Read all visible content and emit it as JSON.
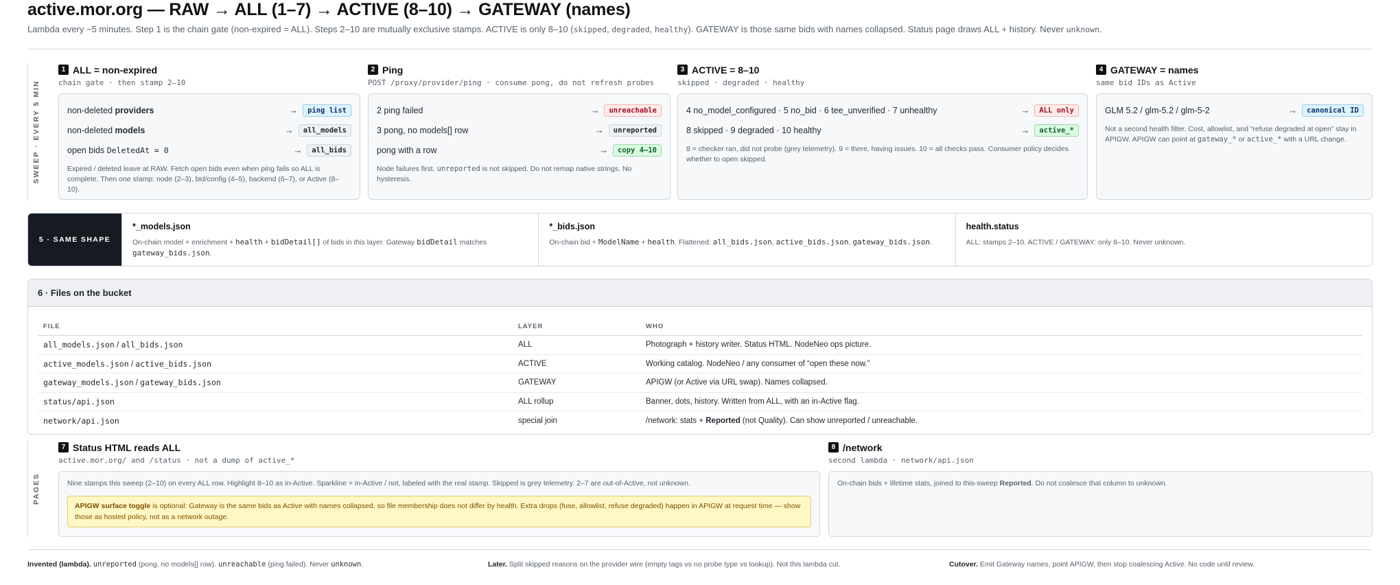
{
  "title": "active.mor.org — RAW → ALL (1–7) → ACTIVE (8–10) → GATEWAY (names)",
  "subtitle": {
    "t1": "Lambda every ~5 minutes. Step 1 is the chain gate (non-expired = ALL). Steps 2–10 are mutually exclusive stamps. ACTIVE is only 8–10 (",
    "m1": "skipped",
    "m2": "degraded",
    "m3": "healthy",
    "t2": "). GATEWAY is those same bids with names collapsed. Status page draws ALL + history. Never ",
    "m4": "unknown",
    "t3": "."
  },
  "sweep_label": "SWEEP · EVERY 5 MIN",
  "pages_label": "PAGES",
  "stages": {
    "s1": {
      "num": "1",
      "title": "ALL = non-expired",
      "sub": "chain gate · then stamp 2–10",
      "rows": [
        {
          "pre": "non-deleted ",
          "bold": "providers",
          "tag": "ping list"
        },
        {
          "pre": "non-deleted ",
          "bold": "models",
          "tag": "all_models"
        },
        {
          "pre": "open bids ",
          "code": "DeletedAt = 0",
          "tag": "all_bids"
        }
      ],
      "note": "Expired / deleted leave at RAW. Fetch open bids even when ping fails so ALL is complete. Then one stamp: node (2–3), bid/config (4–5), backend (6–7), or Active (8–10)."
    },
    "s2": {
      "num": "2",
      "title": "Ping",
      "sub": "POST /proxy/provider/ping · consume pong, do not refresh probes",
      "rows": [
        {
          "text": "2 ping failed",
          "tag": "unreachable"
        },
        {
          "text": "3 pong, no models[] row",
          "tag": "unreported"
        },
        {
          "text": "pong with a row",
          "tag": "copy 4–10"
        }
      ],
      "note_pre": "Node failures first. ",
      "note_code": "unreported",
      "note_post": " is not skipped. Do not remap native strings. No hysteresis."
    },
    "s3": {
      "num": "3",
      "title": "ACTIVE = 8–10",
      "sub": "skipped · degraded · healthy",
      "row1": "4 no_model_configured · 5 no_bid · 6 tee_unverified · 7 unhealthy",
      "tag1": "ALL only",
      "row2": "8 skipped · 9 degraded · 10 healthy",
      "tag2": "active_*",
      "note": "8 = checker ran, did not probe (grey telemetry). 9 = there, having issues. 10 = all checks pass. Consumer policy decides whether to open skipped."
    },
    "s4": {
      "num": "4",
      "title": "GATEWAY = names",
      "sub": "same bid IDs as Active",
      "row": "GLM 5.2 / glm-5.2 / glm-5-2",
      "tag": "canonical ID",
      "note_pre": "Not a second health filter. Cost, allowlist, and “refuse degraded at open” stay in APIGW. APIGW can point at ",
      "note_c1": "gateway_*",
      "note_mid": " or ",
      "note_c2": "active_*",
      "note_post": " with a URL change."
    }
  },
  "same_shape": {
    "label": "5 · SAME SHAPE",
    "c1": {
      "title": "*_models.json",
      "t1": "On-chain model + enrichment + ",
      "m1": "health",
      "t2": " + ",
      "m2": "bidDetail[]",
      "t3": " of bids in ",
      "em": "this",
      "t4": " layer. Gateway ",
      "m3": "bidDetail",
      "t5": " matches ",
      "m4": "gateway_bids.json",
      "t6": "."
    },
    "c2": {
      "title": "*_bids.json",
      "t1": "On-chain bid + ",
      "m1": "ModelName",
      "t2": " + ",
      "m2": "health",
      "t3": ". Flattened: ",
      "m3": "all_bids.json",
      "t4": ", ",
      "m4": "active_bids.json",
      "t5": ", ",
      "m5": "gateway_bids.json",
      "t6": "."
    },
    "c3": {
      "title": "health.status",
      "text": "ALL: stamps 2–10. ACTIVE / GATEWAY: only 8–10. Never unknown."
    }
  },
  "files": {
    "title": "6 · Files on the bucket",
    "headers": {
      "file": "FILE",
      "layer": "LAYER",
      "who": "WHO"
    },
    "rows": [
      {
        "a": "all_models.json",
        "b": "all_bids.json",
        "layer": "ALL",
        "who": "Photograph + history writer. Status HTML. NodeNeo ops picture."
      },
      {
        "a": "active_models.json",
        "b": "active_bids.json",
        "layer": "ACTIVE",
        "who": "Working catalog. NodeNeo / any consumer of “open these now.”"
      },
      {
        "a": "gateway_models.json",
        "b": "gateway_bids.json",
        "layer": "GATEWAY",
        "who": "APIGW (or Active via URL swap). Names collapsed."
      },
      {
        "a": "status/api.json",
        "b": "",
        "layer": "ALL rollup",
        "who": "Banner, dots, history. Written from ALL, with an in-Active flag."
      },
      {
        "a": "network/api.json",
        "b": "",
        "layer": "special join",
        "who_pre": "/network: stats + ",
        "who_bold": "Reported",
        "who_post": " (not Quality). Can show unreported / unreachable."
      }
    ]
  },
  "pages": {
    "p7": {
      "num": "7",
      "title": "Status HTML reads ALL",
      "sub": "active.mor.org/ and /status · not a dump of active_*",
      "text": "Nine stamps this sweep (2–10) on every ALL row. Highlight 8–10 as in-Active. Sparkline = in-Active / not, labeled with the real stamp. Skipped is grey telemetry. 2–7 are out-of-Active, not unknown.",
      "callout_bold": "APIGW surface toggle",
      "callout_text": " is optional: Gateway is the same bids as Active with names collapsed, so file membership does not differ by health. Extra drops (fuse, allowlist, refuse degraded) happen in APIGW at request time — show those as hosted policy, not as a network outage."
    },
    "p8": {
      "num": "8",
      "title": "/network",
      "sub": "second lambda · network/api.json",
      "t1": "On-chain bids + lifetime stats, joined to this-sweep ",
      "bold": "Reported",
      "t2": ". Do not coalesce that column to unknown."
    }
  },
  "footer": {
    "f1": {
      "bold": "Invented (lambda).",
      "m1": "unreported",
      "t1": " (pong, no models[] row). ",
      "m2": "unreachable",
      "t2": " (ping failed). Never ",
      "m3": "unknown",
      "t3": "."
    },
    "f2": {
      "bold": "Later.",
      "text": " Split skipped reasons on the provider wire (empty tags vs no probe type vs lookup). Not this lambda cut."
    },
    "f3": {
      "bold": "Cutover.",
      "text": " Emit Gateway names, point APIGW, then stop coalescing Active. No code until review."
    }
  }
}
